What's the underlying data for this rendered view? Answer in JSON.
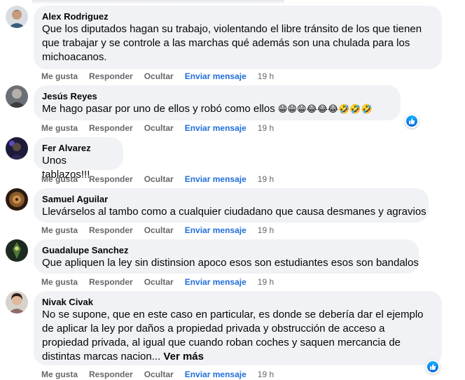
{
  "actions": {
    "like": "Me gusta",
    "reply": "Responder",
    "hide": "Ocultar",
    "message": "Enviar mensaje"
  },
  "comments": [
    {
      "author": "Alex Rodriguez",
      "text": "Que los diputados hagan su trabajo, violentando el libre tránsito de los que tienen que trabajar y se controle a las marchas qué además son una chulada para los michoacanos.",
      "time": "19 h"
    },
    {
      "author": "Jesús Reyes",
      "text": "Me hago pasar por uno de ellos y robó como ellos",
      "emojis": "😁😁😁😂😂😂🤣🤣🤣",
      "time": "19 h",
      "reaction_icon": "like-icon"
    },
    {
      "author": "Fer Alvarez",
      "text": "Unos tablazos!!!",
      "time": "19 h"
    },
    {
      "author": "Samuel Aguilar",
      "text": "Llevárselos al tambo como a cualquier ciudadano que causa desmanes y agravios",
      "time": "19 h"
    },
    {
      "author": "Guadalupe Sanchez",
      "text": "Que apliquen la ley sin distinsion apoco esos son estudiantes esos son bandalos",
      "time": "19 h"
    },
    {
      "author": "Nivak Civak",
      "text": "No se supone, que en este caso en particular, es donde se debería dar el ejemplo de aplicar la ley por daños a propiedad privada y obstrucción de acceso a propiedad privada, al igual que cuando roban coches y saquen mercancia de distintas marcas nacion...",
      "see_more": "Ver más",
      "time": "19 h",
      "reaction_icon": "like-icon"
    }
  ],
  "colors": {
    "bubble": "#f0f2f5",
    "action_text": "#65676b",
    "message_link": "#216fdb",
    "like_blue": "#0866ff"
  }
}
